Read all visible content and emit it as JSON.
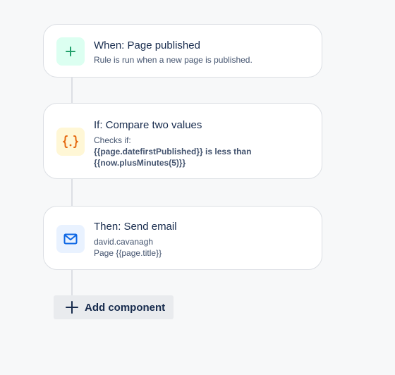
{
  "trigger": {
    "title": "When: Page published",
    "subtitle": "Rule is run when a new page is published.",
    "icon": "plus-icon",
    "icon_color": "#22a06b",
    "icon_bg": "#dcfff1"
  },
  "condition": {
    "title": "If: Compare two values",
    "line1": "Checks if:",
    "line2_value": "{{page.datefirstPublished}}",
    "line2_op": " is less than",
    "line3": "{{now.plusMinutes(5)}}",
    "icon": "braces-icon",
    "icon_color": "#e56910",
    "icon_bg": "#fff7d6"
  },
  "action": {
    "title": "Then: Send email",
    "line1": "david.cavanagh",
    "line2": "Page {{page.title}}",
    "icon": "mail-icon",
    "icon_color": "#0c66e4",
    "icon_bg": "#e9f2ff"
  },
  "add_component": {
    "label": "Add component",
    "icon": "plus-icon"
  }
}
